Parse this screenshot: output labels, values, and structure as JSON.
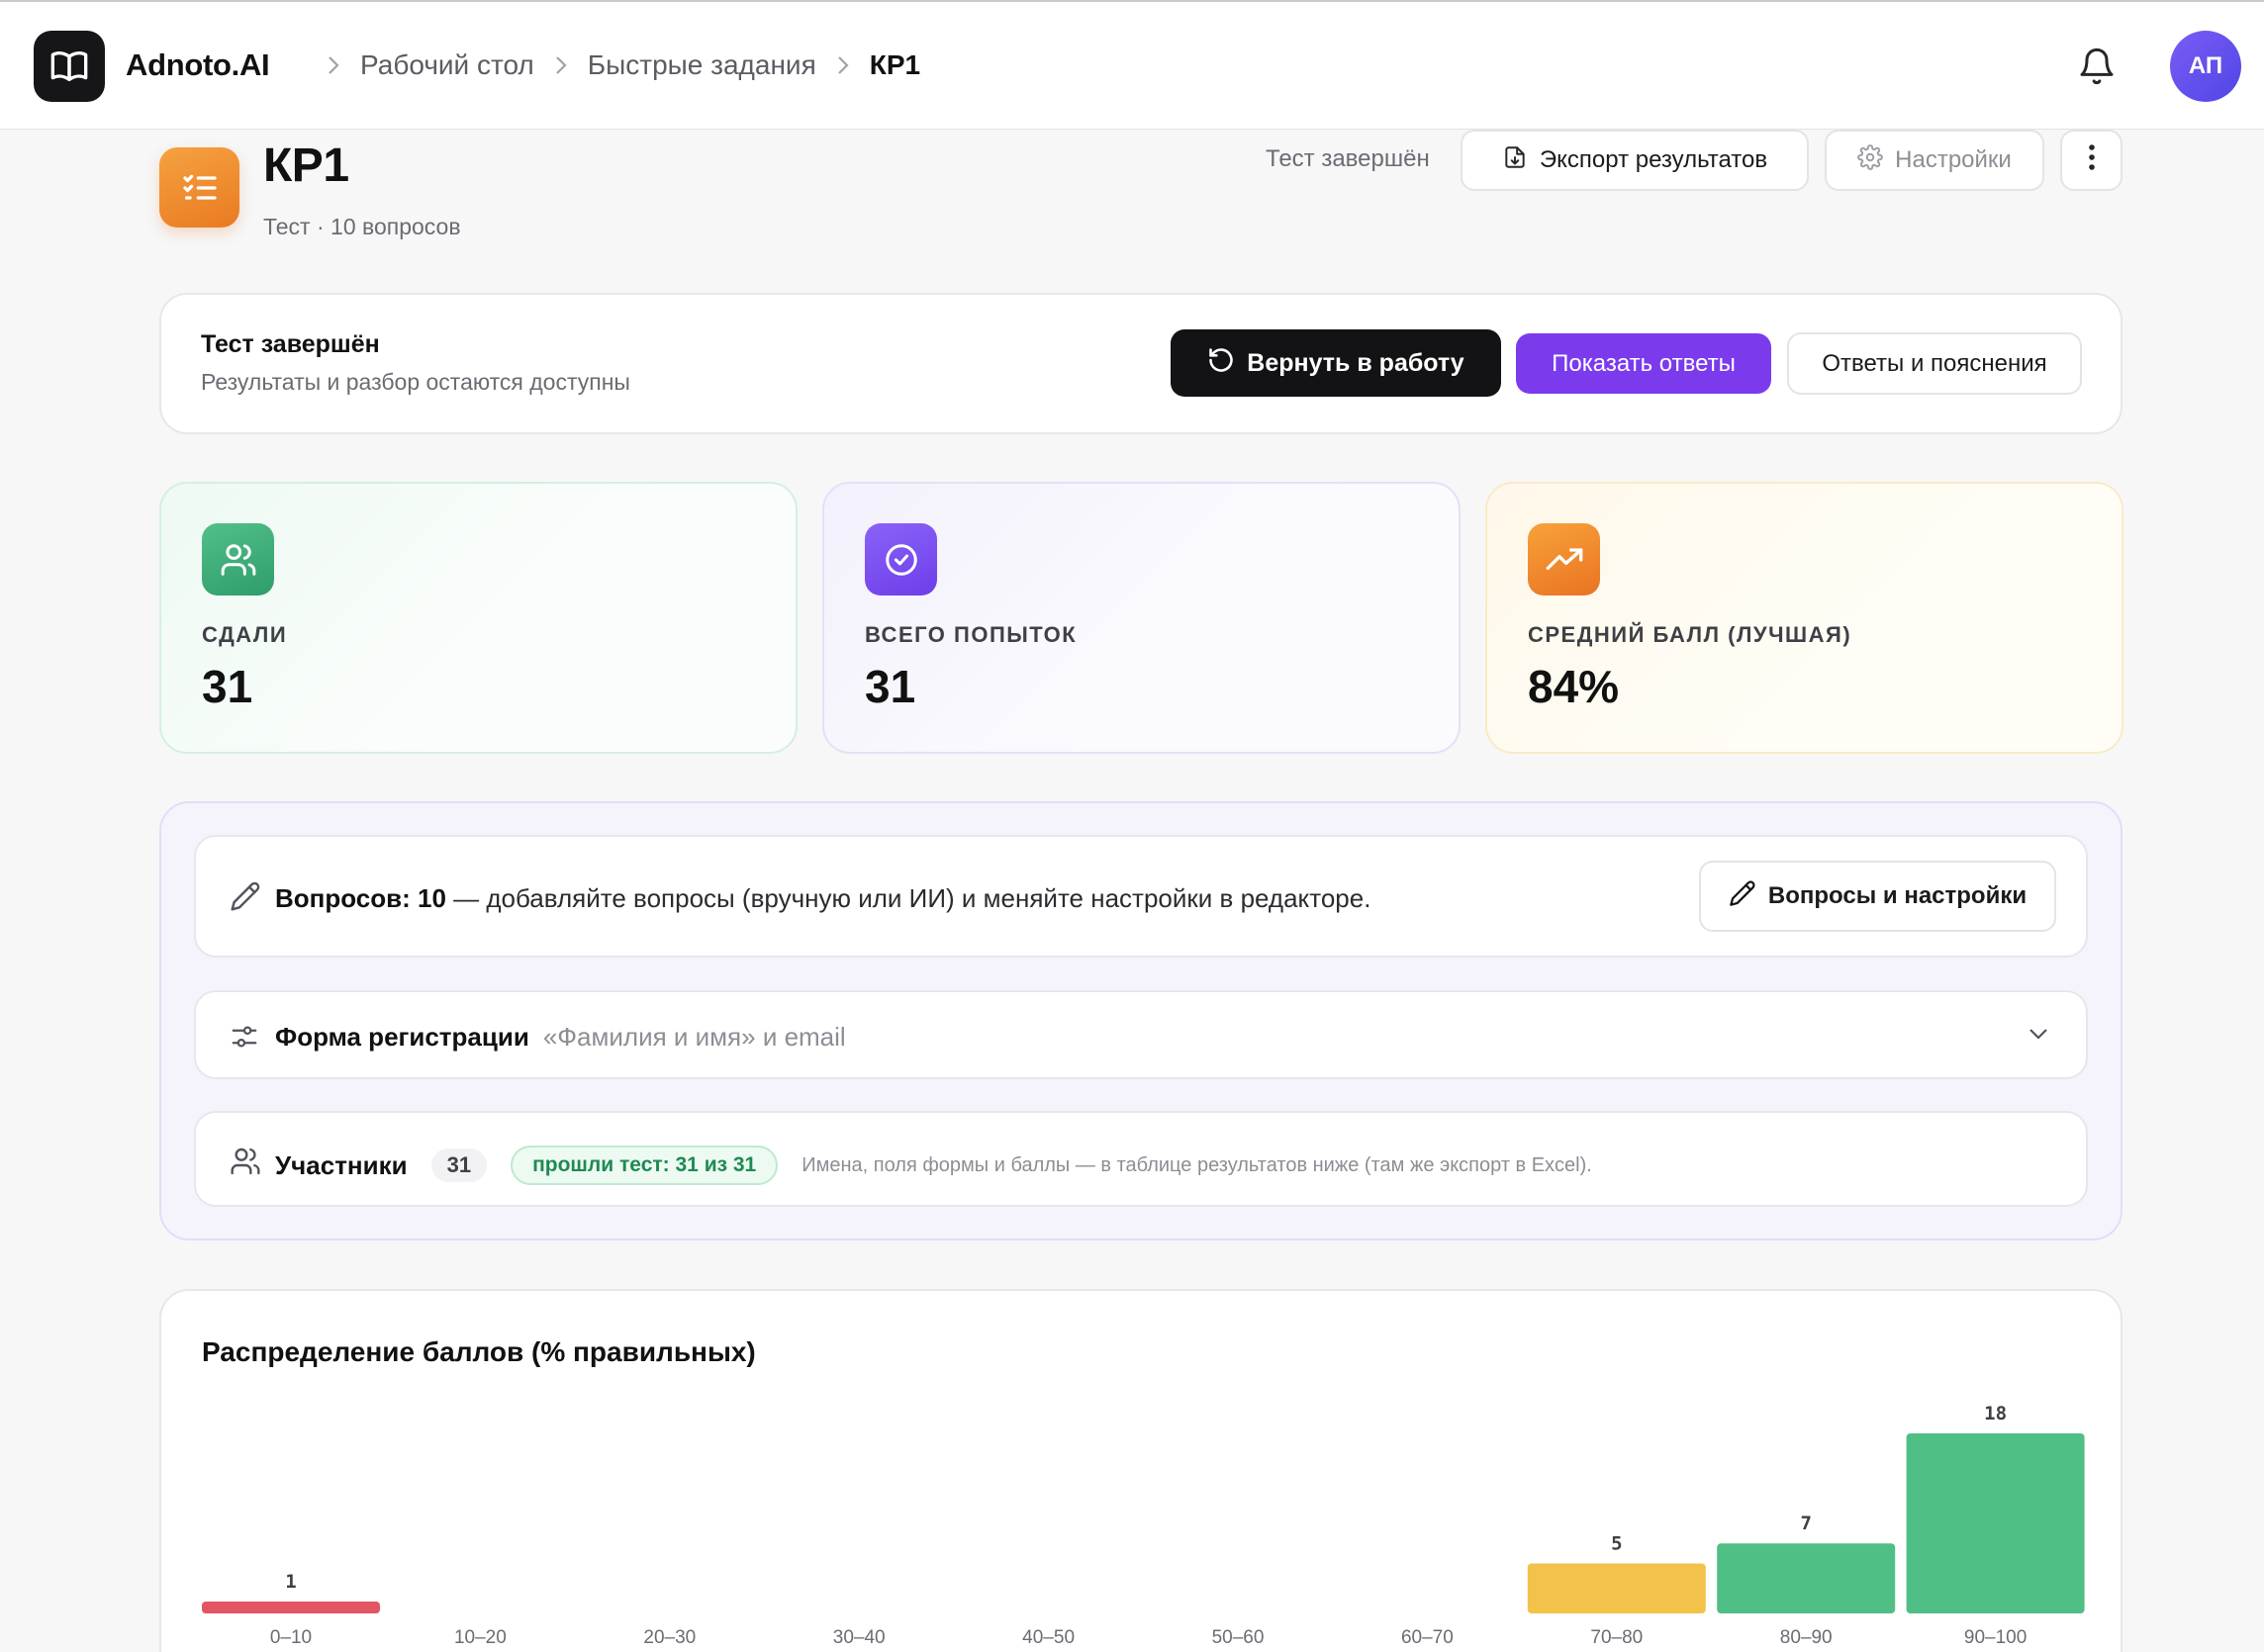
{
  "app": {
    "brand": "Adnoto.AI",
    "avatar_initials": "АП"
  },
  "breadcrumbs": [
    {
      "label": "Рабочий стол"
    },
    {
      "label": "Быстрые задания"
    },
    {
      "label": "КР1"
    }
  ],
  "header": {
    "title": "КР1",
    "subtitle": "Тест · 10 вопросов",
    "status": "Тест завершён",
    "export_label": "Экспорт результатов",
    "settings_label": "Настройки"
  },
  "status_card": {
    "title": "Тест завершён",
    "subtitle": "Результаты и разбор остаются доступны",
    "return_label": "Вернуть в работу",
    "show_answers_label": "Показать ответы",
    "answers_explain_label": "Ответы и пояснения"
  },
  "stats": [
    {
      "label": "СДАЛИ",
      "value": "31",
      "icon": "users-icon",
      "color": "#2f9c6a"
    },
    {
      "label": "ВСЕГО ПОПЫТОК",
      "value": "31",
      "icon": "check-circle-icon",
      "color": "#6d3ee9"
    },
    {
      "label": "СРЕДНИЙ БАЛЛ (ЛУЧШАЯ)",
      "value": "84%",
      "icon": "trending-up-icon",
      "color": "#ea7322"
    }
  ],
  "editor": {
    "questions_bold": "Вопросов: 10",
    "questions_text": " — добавляйте вопросы (вручную или ИИ) и меняйте настройки в редакторе.",
    "questions_button": "Вопросы и настройки",
    "registration_label": "Форма регистрации",
    "registration_value": "«Фамилия и имя» и email",
    "participants_label": "Участники",
    "participants_count": "31",
    "passed_badge": "прошли тест: 31 из 31",
    "participants_note": "Имена, поля формы и баллы — в таблице результатов ниже (там же экспорт в Excel)."
  },
  "chart_data": {
    "type": "bar",
    "title": "Распределение баллов (% правильных)",
    "categories": [
      "0–10",
      "10–20",
      "20–30",
      "30–40",
      "40–50",
      "50–60",
      "60–70",
      "70–80",
      "80–90",
      "90–100"
    ],
    "values": [
      1,
      0,
      0,
      0,
      0,
      0,
      0,
      5,
      7,
      18
    ],
    "colors": [
      "#e25563",
      "#cccccc",
      "#cccccc",
      "#cccccc",
      "#cccccc",
      "#cccccc",
      "#cccccc",
      "#f2c24a",
      "#4fbf85",
      "#4fbf85"
    ],
    "ylim": [
      0,
      18
    ]
  }
}
